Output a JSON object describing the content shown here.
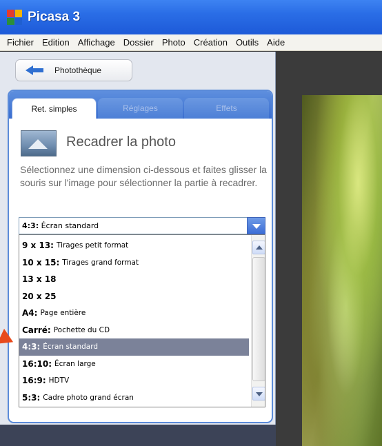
{
  "window": {
    "title": "Picasa 3"
  },
  "menu": [
    "Fichier",
    "Edition",
    "Affichage",
    "Dossier",
    "Photo",
    "Création",
    "Outils",
    "Aide"
  ],
  "back_button": {
    "label": "Photothèque"
  },
  "tabs": [
    {
      "label": "Ret. simples",
      "active": true
    },
    {
      "label": "Réglages",
      "active": false
    },
    {
      "label": "Effets",
      "active": false
    }
  ],
  "crop": {
    "heading": "Recadrer la photo",
    "description": "Sélectionnez une dimension ci-dessous et faites glisser la souris sur l'image pour sélectionner la partie à recadrer."
  },
  "select": {
    "key": "4:3:",
    "desc": "Écran standard"
  },
  "options": [
    {
      "key": "9 x 13:",
      "desc": "Tirages petit format"
    },
    {
      "key": "10 x 15:",
      "desc": "Tirages grand format"
    },
    {
      "key": "13 x 18",
      "desc": ""
    },
    {
      "key": "20 x 25",
      "desc": ""
    },
    {
      "key": "A4:",
      "desc": "Page entière"
    },
    {
      "key": "Carré:",
      "desc": "Pochette du CD"
    },
    {
      "key": "4:3:",
      "desc": "Écran standard",
      "selected": true
    },
    {
      "key": "16:10:",
      "desc": "Écran large"
    },
    {
      "key": "16:9:",
      "desc": "HDTV"
    },
    {
      "key": "5:3:",
      "desc": "Cadre photo grand écran"
    }
  ],
  "colors": {
    "titlebar": "#2a6de6",
    "selection": "#7b8299",
    "callout": "#e84a1c"
  }
}
